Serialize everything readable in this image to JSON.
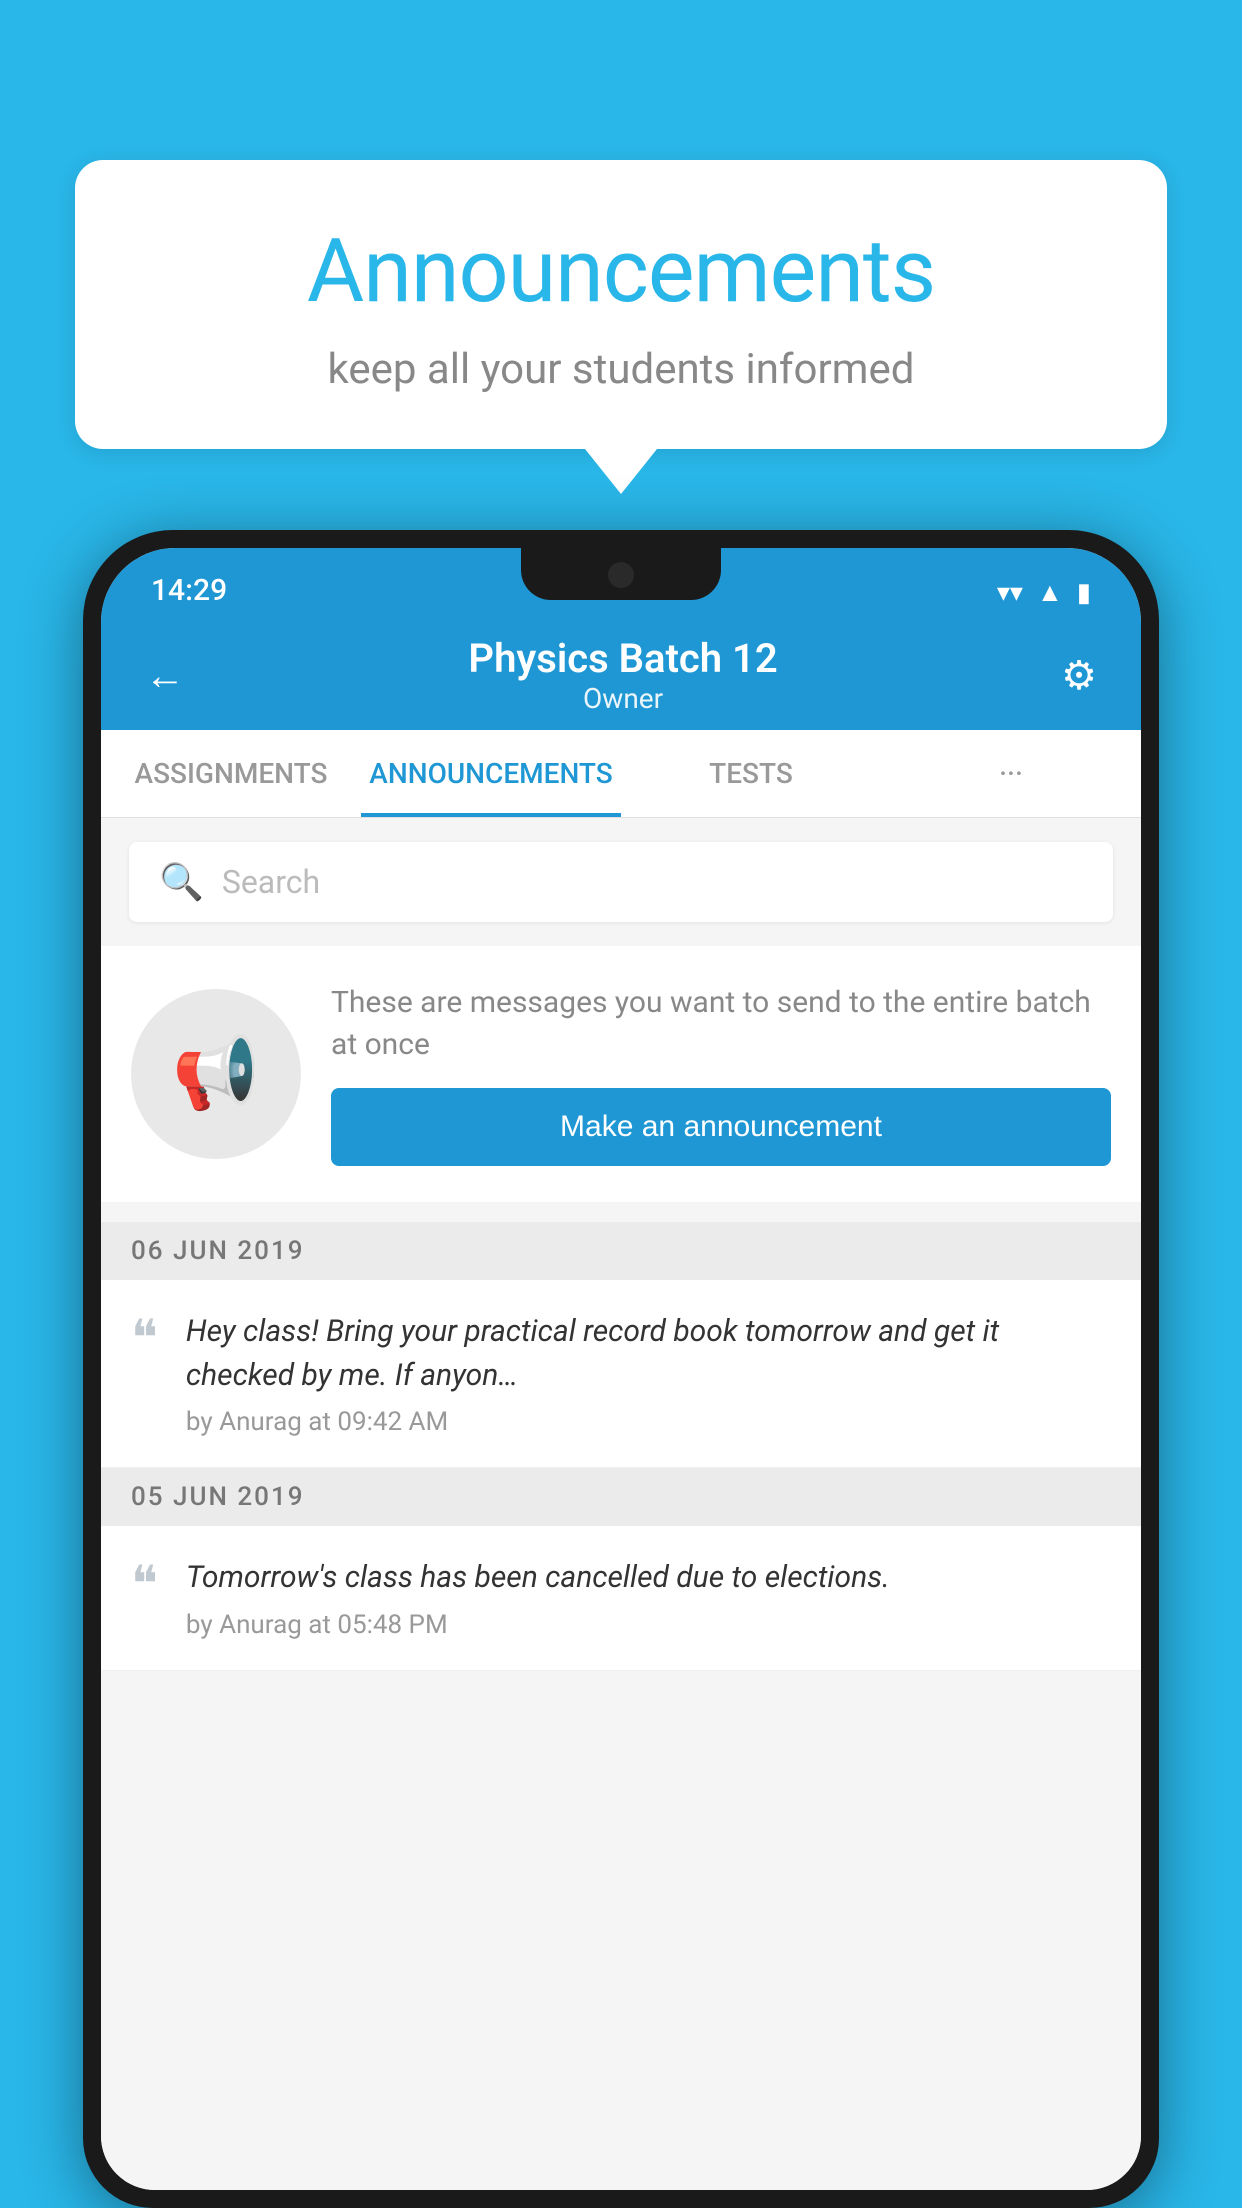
{
  "background_color": "#29b6e8",
  "speech_bubble": {
    "title": "Announcements",
    "subtitle": "keep all your students informed"
  },
  "status_bar": {
    "time": "14:29",
    "wifi_icon": "▼",
    "signal_icon": "▲",
    "battery_icon": "▮"
  },
  "app_bar": {
    "title": "Physics Batch 12",
    "subtitle": "Owner",
    "back_label": "←",
    "gear_label": "⚙"
  },
  "tabs": [
    {
      "label": "ASSIGNMENTS",
      "active": false
    },
    {
      "label": "ANNOUNCEMENTS",
      "active": true
    },
    {
      "label": "TESTS",
      "active": false
    },
    {
      "label": "···",
      "active": false
    }
  ],
  "search": {
    "placeholder": "Search"
  },
  "promo": {
    "description": "These are messages you want to send to the entire batch at once",
    "button_label": "Make an announcement"
  },
  "announcements": [
    {
      "date": "06  JUN  2019",
      "message": "Hey class! Bring your practical record book tomorrow and get it checked by me. If anyon…",
      "meta": "by Anurag at 09:42 AM"
    },
    {
      "date": "05  JUN  2019",
      "message": "Tomorrow's class has been cancelled due to elections.",
      "meta": "by Anurag at 05:48 PM"
    }
  ]
}
